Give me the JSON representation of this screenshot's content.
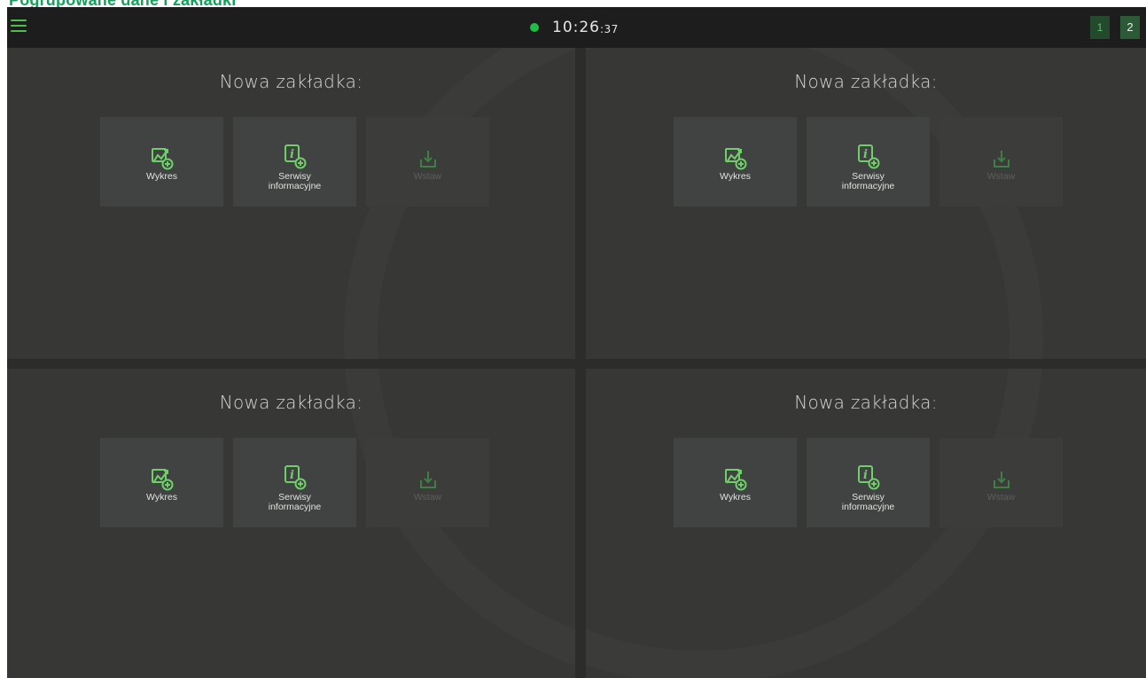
{
  "caption": "Pogrupowane dane i zakładki",
  "topbar": {
    "menu_icon": "hamburger-icon",
    "status_color": "#1fbe45",
    "time_main": "10:26",
    "time_seconds": ":37",
    "pages": [
      "1",
      "2"
    ],
    "active_page": "2"
  },
  "theme": {
    "accent": "#4fc04f",
    "background": "#2c2c2a",
    "panel": "#373836",
    "tile": "#404341"
  },
  "panels": [
    {
      "title": "Nowa zakładka:",
      "tiles": [
        {
          "label": "Wykres",
          "icon": "chart-add-icon",
          "enabled": true
        },
        {
          "label": "Serwisy informacyjne",
          "icon": "info-add-icon",
          "enabled": true
        },
        {
          "label": "Wstaw",
          "icon": "insert-download-icon",
          "enabled": false
        }
      ]
    },
    {
      "title": "Nowa zakładka:",
      "tiles": [
        {
          "label": "Wykres",
          "icon": "chart-add-icon",
          "enabled": true
        },
        {
          "label": "Serwisy informacyjne",
          "icon": "info-add-icon",
          "enabled": true
        },
        {
          "label": "Wstaw",
          "icon": "insert-download-icon",
          "enabled": false
        }
      ]
    },
    {
      "title": "Nowa zakładka:",
      "tiles": [
        {
          "label": "Wykres",
          "icon": "chart-add-icon",
          "enabled": true
        },
        {
          "label": "Serwisy informacyjne",
          "icon": "info-add-icon",
          "enabled": true
        },
        {
          "label": "Wstaw",
          "icon": "insert-download-icon",
          "enabled": false
        }
      ]
    },
    {
      "title": "Nowa zakładka:",
      "tiles": [
        {
          "label": "Wykres",
          "icon": "chart-add-icon",
          "enabled": true
        },
        {
          "label": "Serwisy informacyjne",
          "icon": "info-add-icon",
          "enabled": true
        },
        {
          "label": "Wstaw",
          "icon": "insert-download-icon",
          "enabled": false
        }
      ]
    }
  ]
}
